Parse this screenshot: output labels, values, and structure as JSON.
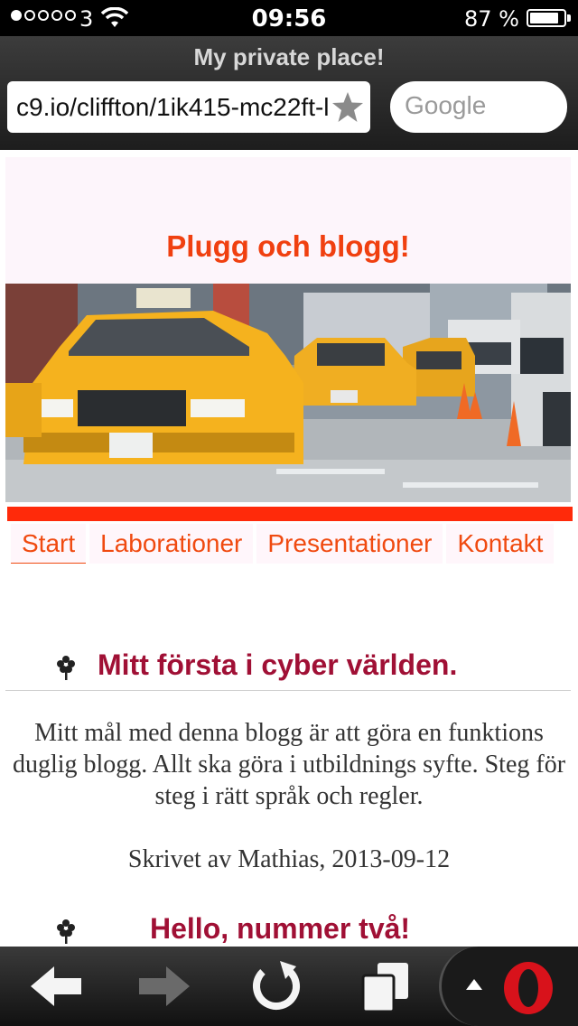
{
  "status_bar": {
    "carrier": "3",
    "time": "09:56",
    "battery_percent": "87 %",
    "battery_level": 0.87,
    "signal_bars": 1
  },
  "browser": {
    "page_title": "My private place!",
    "url": "c9.io/cliffton/1ik415-mc22ft-l",
    "search_placeholder": "Google"
  },
  "blog": {
    "title": "Plugg och blogg!",
    "hero_image": "yellow-taxi-street-photo"
  },
  "nav": {
    "items": [
      {
        "label": "Start"
      },
      {
        "label": "Laborationer"
      },
      {
        "label": "Presentationer"
      },
      {
        "label": "Kontakt"
      }
    ]
  },
  "posts": [
    {
      "title": "Mitt första i cyber världen.",
      "body": "Mitt mål med denna blogg är att göra en funktions duglig blogg. Allt ska göra i utbildnings syfte. Steg för steg i rätt språk och regler.",
      "meta": "Skrivet av Mathias, 2013-09-12",
      "icon": "tree-icon"
    },
    {
      "title": "Hello, nummer två!",
      "icon": "tree-icon"
    }
  ],
  "colors": {
    "blog_title": "#f04010",
    "nav_rule": "#ff2a0a",
    "post_title": "#a01035",
    "opera_red": "#d8121b"
  },
  "toolbar": {
    "icons": [
      "back-arrow-icon",
      "forward-arrow-icon",
      "reload-icon",
      "tabs-icon",
      "menu-up-icon",
      "opera-logo-icon"
    ]
  }
}
